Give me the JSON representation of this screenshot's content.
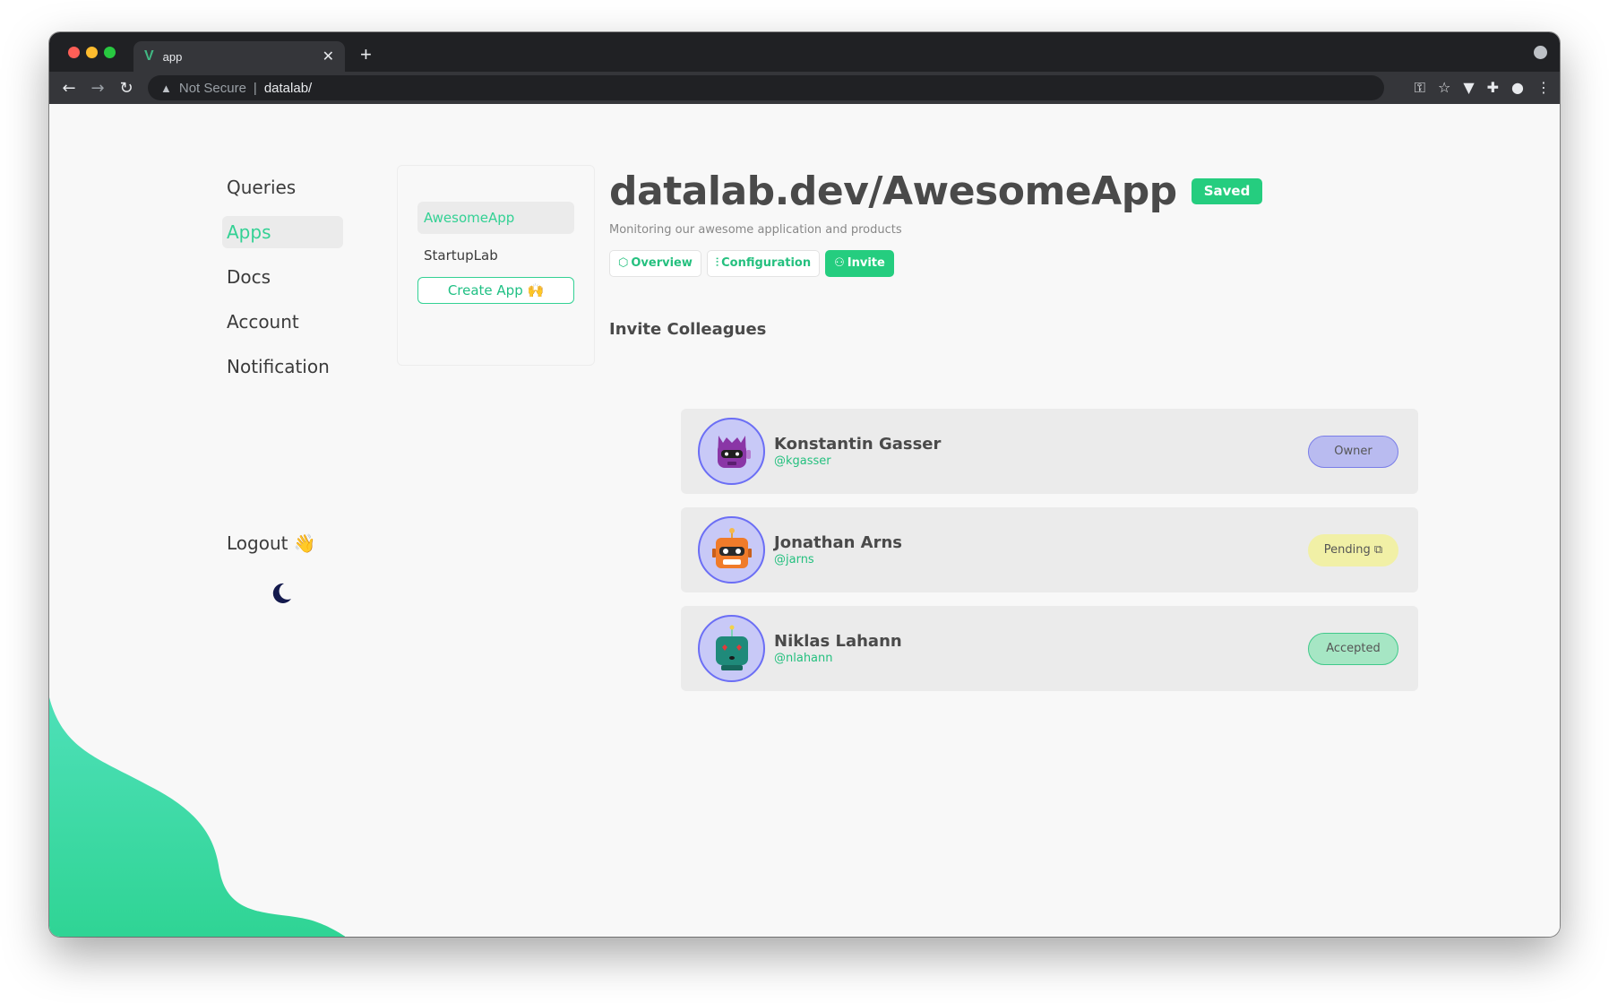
{
  "browser": {
    "tab_title": "app",
    "security_label": "Not Secure",
    "url": "datalab/"
  },
  "sidebar": {
    "items": [
      {
        "label": "Queries",
        "active": false
      },
      {
        "label": "Apps",
        "active": true
      },
      {
        "label": "Docs",
        "active": false
      },
      {
        "label": "Account",
        "active": false
      },
      {
        "label": "Notification",
        "active": false
      }
    ],
    "logout_label": "Logout 👋"
  },
  "apps_panel": {
    "apps": [
      {
        "label": "AwesomeApp",
        "active": true
      },
      {
        "label": "StartupLab",
        "active": false
      }
    ],
    "create_label": "Create App 🙌"
  },
  "main": {
    "title": "datalab.dev/AwesomeApp",
    "saved_badge": "Saved",
    "subtitle": "Monitoring our awesome application and products",
    "tabs": [
      {
        "label": "Overview",
        "icon": "cube-icon",
        "active": false
      },
      {
        "label": "Configuration",
        "icon": "sliders-icon",
        "active": false
      },
      {
        "label": "Invite",
        "icon": "users-icon",
        "active": true
      }
    ],
    "section_title": "Invite Colleagues"
  },
  "members": [
    {
      "name": "Konstantin Gasser",
      "handle": "@kgasser",
      "role": "Owner",
      "avatar": "purple-robot-avatar"
    },
    {
      "name": "Jonathan Arns",
      "handle": "@jarns",
      "role": "Pending",
      "avatar": "orange-robot-avatar"
    },
    {
      "name": "Niklas Lahann",
      "handle": "@nlahann",
      "role": "Accepted",
      "avatar": "teal-robot-avatar"
    }
  ],
  "colors": {
    "accent": "#25cd7f",
    "owner": "#b9bbf0",
    "pending": "#f1f0a6",
    "accepted": "#a6e6c4"
  }
}
